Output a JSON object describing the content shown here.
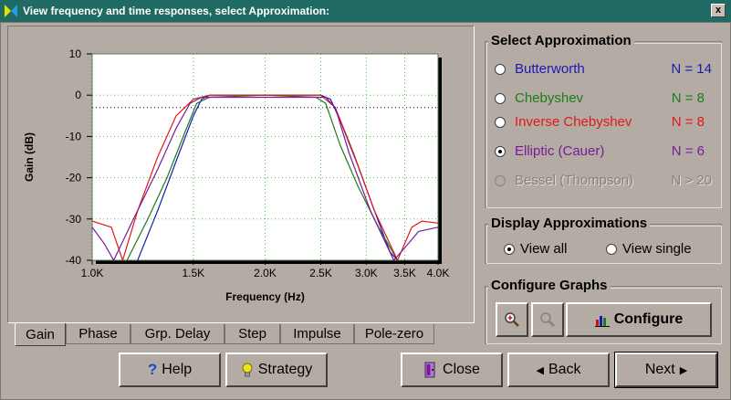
{
  "window": {
    "title": "View frequency and time responses, select Approximation:",
    "close_label": "x"
  },
  "tabs": [
    {
      "label": "Gain",
      "active": true
    },
    {
      "label": "Phase",
      "active": false
    },
    {
      "label": "Grp. Delay",
      "active": false
    },
    {
      "label": "Step",
      "active": false
    },
    {
      "label": "Impulse",
      "active": false
    },
    {
      "label": "Pole-zero",
      "active": false
    }
  ],
  "select_approximation": {
    "title": "Select Approximation",
    "options": [
      {
        "label": "Butterworth",
        "n": "N = 14",
        "color": "#1a1ab0",
        "checked": false,
        "disabled": false
      },
      {
        "label": "Chebyshev",
        "n": "N = 8",
        "color": "#1d7a1d",
        "checked": false,
        "disabled": false
      },
      {
        "label": "Inverse Chebyshev",
        "n": "N = 8",
        "color": "#e01818",
        "checked": false,
        "disabled": false
      },
      {
        "label": "Elliptic  (Cauer)",
        "n": "N = 6",
        "color": "#7a1a9a",
        "checked": true,
        "disabled": false
      },
      {
        "label": "Bessel (Thompson)",
        "n": "N > 20",
        "color": "#8a8278",
        "checked": false,
        "disabled": true
      }
    ]
  },
  "display_approximations": {
    "title": "Display Approximations",
    "view_all": "View all",
    "view_single": "View single",
    "selected": "view_all"
  },
  "configure_graphs": {
    "title": "Configure Graphs",
    "configure_label": "Configure"
  },
  "buttons": {
    "help": "Help",
    "strategy": "Strategy",
    "close": "Close",
    "back": "Back",
    "next": "Next"
  },
  "chart_data": {
    "type": "line",
    "xlabel": "Frequency  (Hz)",
    "ylabel": "Gain  (dB)",
    "x_ticks": [
      "1.0K",
      "1.5K",
      "2.0K",
      "2.5K",
      "3.0K",
      "3.5K",
      "4.0K"
    ],
    "y_ticks": [
      "10",
      "0",
      "-10",
      "-20",
      "-30",
      "-40"
    ],
    "xlim": [
      1000,
      4000
    ],
    "ylim": [
      -40,
      10
    ],
    "x_scale": "log",
    "grid": true,
    "reference_line_db": -3,
    "series": [
      {
        "name": "Butterworth",
        "color": "#1a1ab0",
        "x": [
          1200,
          1300,
          1400,
          1500,
          1550,
          1600,
          2000,
          2500,
          2600,
          2700,
          2900,
          3100,
          3300,
          3400
        ],
        "y": [
          -40,
          -28,
          -16,
          -5,
          -1,
          0,
          0,
          0,
          -1,
          -6,
          -17,
          -28,
          -38,
          -40
        ]
      },
      {
        "name": "Chebyshev",
        "color": "#1d7a1d",
        "x": [
          1150,
          1250,
          1350,
          1450,
          1520,
          1600,
          2000,
          2450,
          2550,
          2700,
          2900,
          3150,
          3400
        ],
        "y": [
          -40,
          -30,
          -20,
          -9,
          -2,
          -0.5,
          0,
          -0.5,
          -2,
          -12,
          -22,
          -32,
          -40
        ]
      },
      {
        "name": "Inverse Chebyshev",
        "color": "#e01818",
        "x": [
          1000,
          1080,
          1130,
          1200,
          1300,
          1400,
          1500,
          1600,
          2000,
          2500,
          2650,
          2850,
          3100,
          3400,
          3600,
          3750,
          4000
        ],
        "y": [
          -30.5,
          -32,
          -40,
          -28,
          -15,
          -5,
          -1,
          0,
          0,
          0,
          -3,
          -14,
          -28,
          -40,
          -32,
          -30.5,
          -31
        ]
      },
      {
        "name": "Elliptic  (Cauer)",
        "color": "#7a1a9a",
        "x": [
          1000,
          1050,
          1090,
          1180,
          1300,
          1400,
          1480,
          1550,
          2000,
          2550,
          2650,
          2800,
          3050,
          3350,
          3500,
          3700,
          4000
        ],
        "y": [
          -32,
          -36,
          -40,
          -30,
          -18,
          -8,
          -2,
          -0.5,
          -0.5,
          -0.5,
          -3,
          -14,
          -28,
          -40,
          -37,
          -33,
          -32
        ]
      }
    ]
  }
}
